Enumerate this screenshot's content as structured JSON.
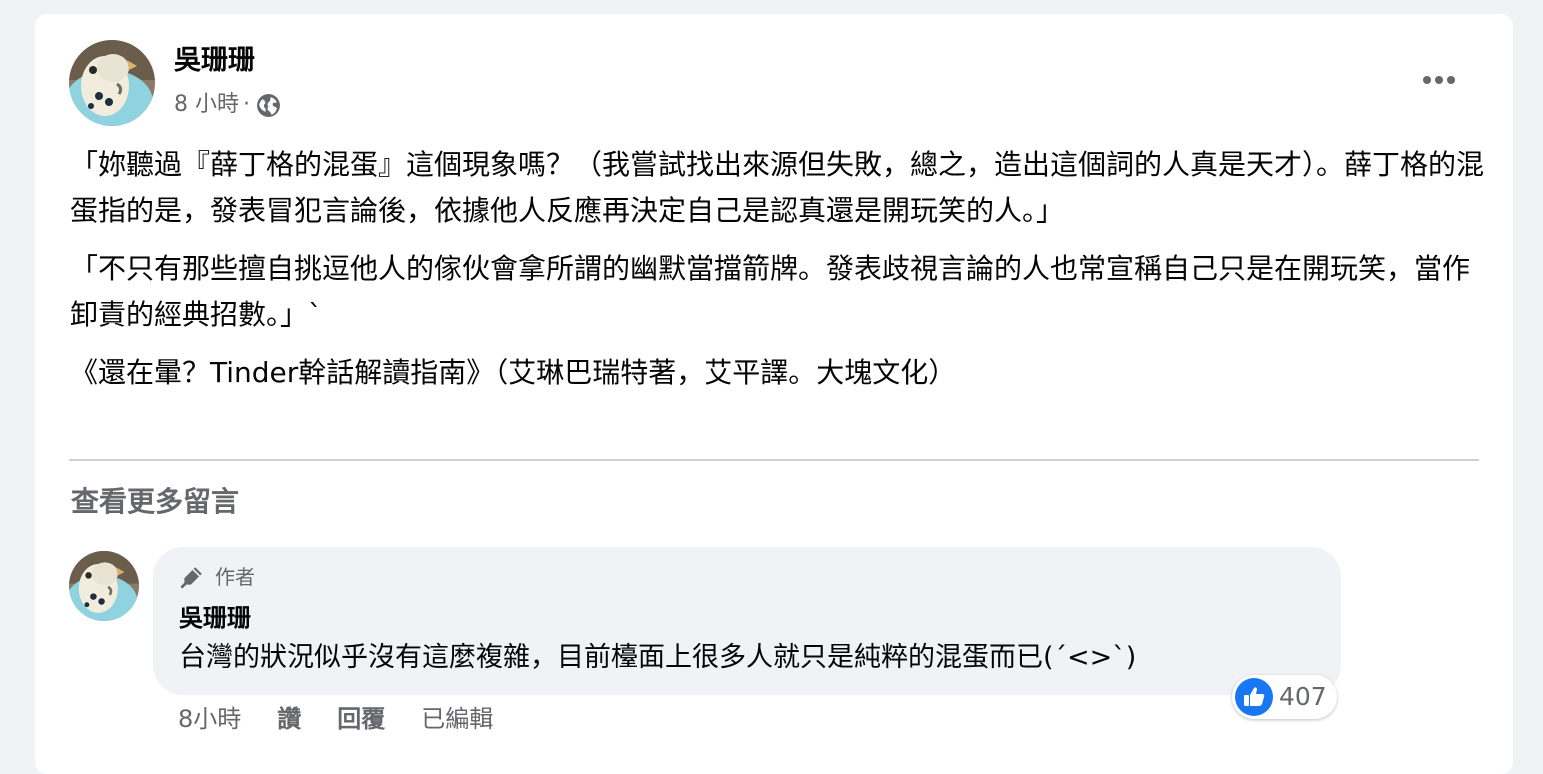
{
  "post": {
    "author": "吳珊珊",
    "time": "8 小時",
    "separator": "·",
    "privacy_icon": "globe-icon",
    "more_icon": "more-horizontal-icon",
    "paragraphs": [
      "「妳聽過『薛丁格的混蛋』這個現象嗎？（我嘗試找出來源但失敗，總之，造出這個詞的人真是天才）。薛丁格的混蛋指的是，發表冒犯言論後，依據他人反應再決定自己是認真還是開玩笑的人。」",
      "「不只有那些擅自挑逗他人的傢伙會拿所謂的幽默當擋箭牌。發表歧視言論的人也常宣稱自己只是在開玩笑，當作卸責的經典招數。」`",
      "《還在暈？Tinder幹話解讀指南》（艾琳巴瑞特著，艾平譯。大塊文化）"
    ]
  },
  "comments_section": {
    "view_more_label": "查看更多留言",
    "comment": {
      "badge_icon": "pen-icon",
      "badge_label": "作者",
      "author": "吳珊珊",
      "text": "台灣的狀況似乎沒有這麼複雜，目前檯面上很多人就只是純粹的混蛋而已(ˊ<>ˋ)",
      "reaction_icon": "like-icon",
      "reaction_count": "407",
      "time": "8小時",
      "like_label": "讚",
      "reply_label": "回覆",
      "edited_label": "已編輯"
    }
  },
  "colors": {
    "page_background": "#f0f2f5",
    "card_background": "#ffffff",
    "primary_text": "#050505",
    "secondary_text": "#65676b",
    "like_blue": "#1877f2"
  }
}
